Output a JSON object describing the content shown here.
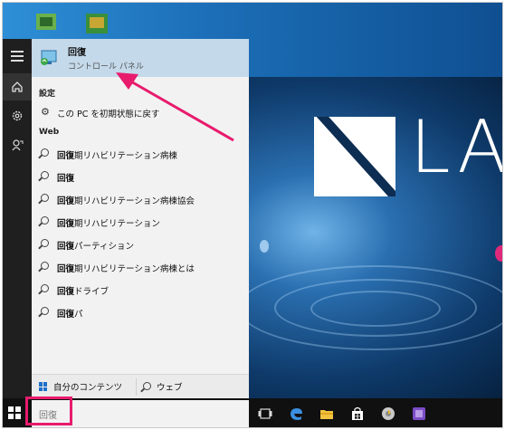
{
  "top_result": {
    "name": "回復",
    "sub": "コントロール パネル"
  },
  "settings": {
    "heading": "設定",
    "items": [
      {
        "label": "この PC を初期状態に戻す"
      }
    ]
  },
  "web": {
    "heading": "Web",
    "items": [
      {
        "bold": "回復",
        "rest": "期リハビリテーション病棟"
      },
      {
        "bold": "回復",
        "rest": ""
      },
      {
        "bold": "回復",
        "rest": "期リハビリテーション病棟協会"
      },
      {
        "bold": "回復",
        "rest": "期リハビリテーション"
      },
      {
        "bold": "回復",
        "rest": "パーティション"
      },
      {
        "bold": "回復",
        "rest": "期リハビリテーション病棟とは"
      },
      {
        "bold": "回復",
        "rest": "ドライブ"
      },
      {
        "bold": "回復",
        "rest": "パ"
      }
    ]
  },
  "bottom": {
    "my_content": "自分のコンテンツ",
    "web": "ウェブ"
  },
  "search": {
    "value": "回復"
  },
  "wallpaper": {
    "logo_text": "LA"
  },
  "colors": {
    "highlight": "#e81b6d",
    "accent": "#1e6fc9",
    "selected_row": "#c4d9ea"
  }
}
